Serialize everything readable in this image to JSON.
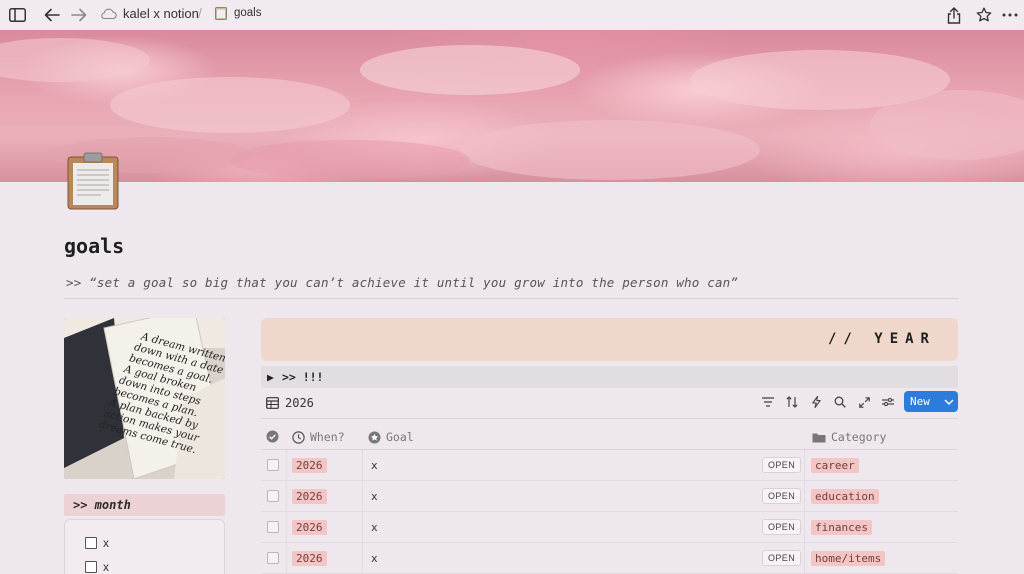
{
  "topbar": {
    "workspace": "kalel x notion",
    "page": "goals"
  },
  "page": {
    "title": "goals",
    "quote": ">> “set a goal so big that you can’t achieve it until you grow into the person who can”"
  },
  "left": {
    "book_text": [
      "A dream written",
      "down with a date",
      "becomes a goal.",
      "A goal broken",
      "down into steps",
      "becomes a plan.",
      "A plan backed by",
      "action makes your",
      "dreams come true."
    ],
    "month_label": ">> month",
    "todos": [
      {
        "label": "x"
      },
      {
        "label": "x"
      }
    ]
  },
  "board": {
    "year_banner": "// YEAR",
    "toggle": ">> !!!",
    "view_name": "2026",
    "new_label": "New",
    "headers": {
      "when": "When?",
      "goal": "Goal",
      "category": "Category"
    },
    "open_label": "OPEN",
    "rows": [
      {
        "when": "2026",
        "goal": "x",
        "category": "career"
      },
      {
        "when": "2026",
        "goal": "x",
        "category": "education"
      },
      {
        "when": "2026",
        "goal": "x",
        "category": "finances"
      },
      {
        "when": "2026",
        "goal": "x",
        "category": "home/items"
      }
    ]
  },
  "colors": {
    "accent_button": "#2c7ddb",
    "tag_bg": "#f1c6c4",
    "banner_bg": "#efd8cb",
    "page_bg": "#efe7ee"
  }
}
